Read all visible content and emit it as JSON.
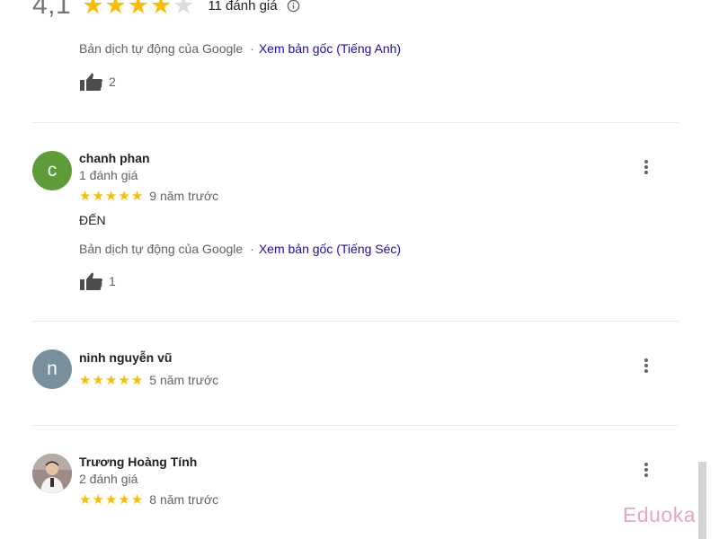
{
  "header": {
    "rating": "4,1",
    "rating_value": 4.1,
    "review_count": "11 đánh giá",
    "icon": "info-icon"
  },
  "first_review_tail": {
    "translation_label": "Bản dịch tự động của Google",
    "separator": "·",
    "view_original": "Xem bản gốc (Tiếng Anh)",
    "likes": "2"
  },
  "reviews": [
    {
      "avatar_letter": "c",
      "avatar_color": "#5e9b39",
      "name": "chanh phan",
      "meta": "1 đánh giá",
      "stars": 5,
      "time": "9 năm trước",
      "text": "ĐẾN",
      "translation_label": "Bản dịch tự động của Google",
      "separator": "·",
      "view_original": "Xem bản gốc (Tiếng Séc)",
      "likes": "1"
    },
    {
      "avatar_letter": "n",
      "avatar_color": "#78909c",
      "name": "ninh nguyễn vũ",
      "stars": 5,
      "time": "5 năm trước"
    },
    {
      "avatar_type": "photo",
      "name": "Trương Hoàng Tính",
      "meta": "2 đánh giá",
      "stars": 5,
      "time": "8 năm trước"
    }
  ],
  "watermark": "Eduoka",
  "colors": {
    "star": "#fbbc04",
    "link": "#1a0dab",
    "secondary_text": "#5f6368"
  }
}
